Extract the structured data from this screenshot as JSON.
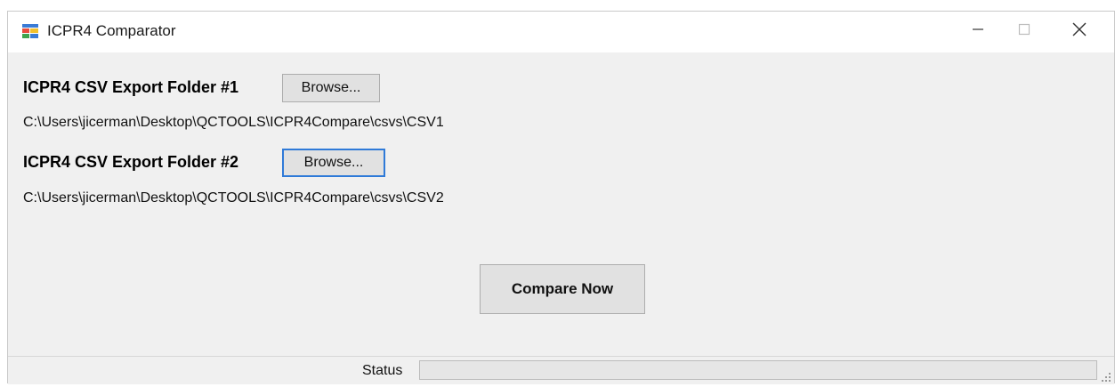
{
  "window": {
    "title": "ICPR4 Comparator",
    "icon": "windows-forms-app-icon",
    "controls": {
      "minimize_icon": "minimize-icon",
      "maximize_icon": "maximize-icon",
      "close_icon": "close-icon"
    }
  },
  "folder1": {
    "label": "ICPR4 CSV Export Folder #1",
    "browse_label": "Browse...",
    "path": "C:\\Users\\jicerman\\Desktop\\QCTOOLS\\ICPR4Compare\\csvs\\CSV1"
  },
  "folder2": {
    "label": "ICPR4 CSV Export Folder #2",
    "browse_label": "Browse...",
    "path": "C:\\Users\\jicerman\\Desktop\\QCTOOLS\\ICPR4Compare\\csvs\\CSV2"
  },
  "actions": {
    "compare_label": "Compare Now"
  },
  "status": {
    "label": "Status",
    "progress_fraction": 0
  },
  "colors": {
    "accent": "#2f7ad8",
    "window_bg": "#f0f0f0",
    "button_bg": "#e1e1e1"
  }
}
